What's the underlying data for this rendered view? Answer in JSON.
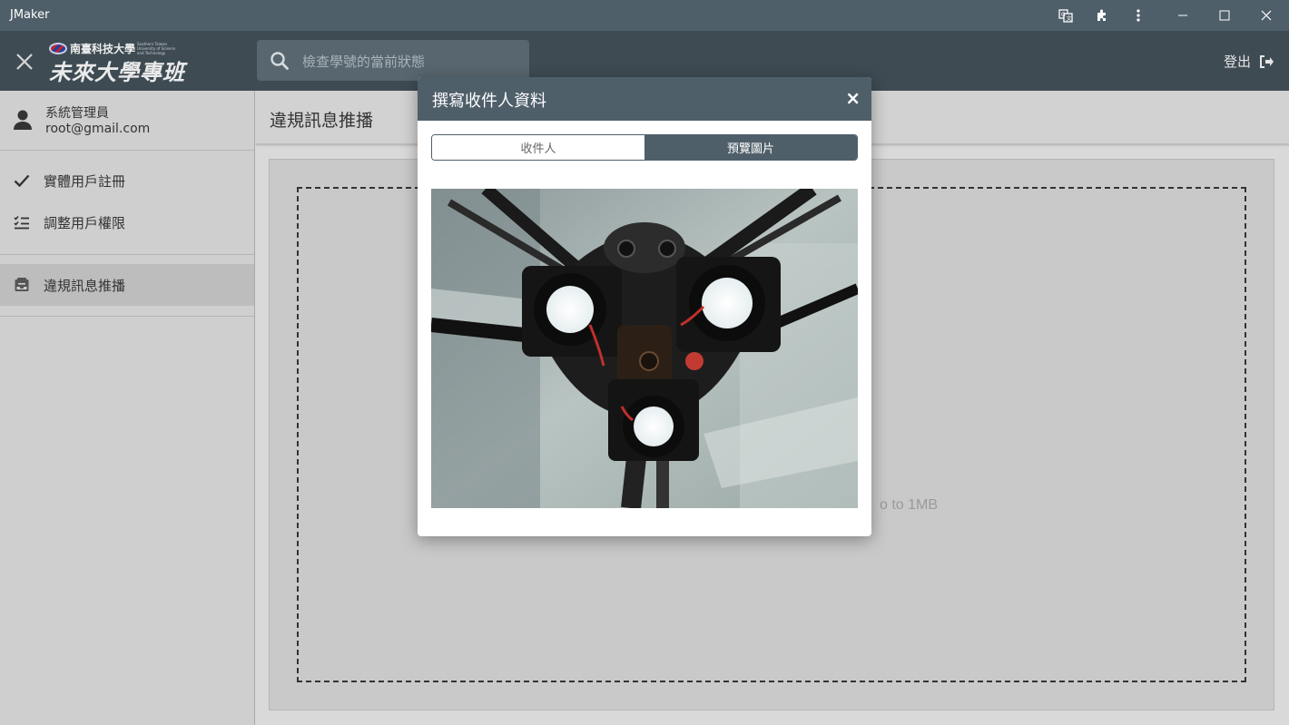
{
  "window": {
    "title": "JMaker",
    "buttons": [
      {
        "name": "translate-icon"
      },
      {
        "name": "extensions-icon"
      },
      {
        "name": "more-vert-icon"
      },
      {
        "name": "minimize-icon"
      },
      {
        "name": "maximize-icon"
      },
      {
        "name": "close-icon"
      }
    ]
  },
  "header": {
    "logo_small_cn": "南臺科技大學",
    "logo_small_en": "Southern Taiwan University of Science and Technology",
    "logo_big": "未來大學專班",
    "search_placeholder": "檢查學號的當前狀態",
    "logout_label": "登出"
  },
  "sidebar": {
    "user_name": "系統管理員",
    "user_email": "root@gmail.com",
    "items": [
      {
        "label": "實體用戶註冊",
        "icon": "check-icon"
      },
      {
        "label": "調整用戶權限",
        "icon": "checklist-icon"
      },
      {
        "label": "違規訊息推播",
        "icon": "inbox-icon",
        "active": true
      }
    ]
  },
  "main": {
    "page_title": "違規訊息推播",
    "dropzone_hint": "o to 1MB"
  },
  "modal": {
    "title": "撰寫收件人資料",
    "close": "×",
    "tabs": [
      {
        "label": "收件人",
        "selected": false
      },
      {
        "label": "預覽圖片",
        "selected": true
      }
    ],
    "preview_image": "3d-printer-hotend-fans-photo"
  },
  "colors": {
    "titlebar": "#4f5f6a",
    "header": "#3e4b53",
    "accent": "#4f5f6a",
    "overlay": "#d9d9d9"
  }
}
